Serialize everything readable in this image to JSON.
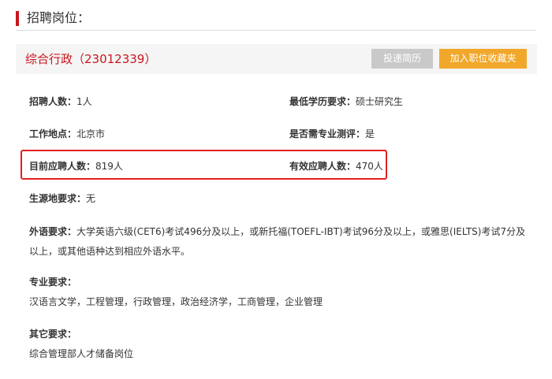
{
  "section": {
    "title": "招聘岗位："
  },
  "job": {
    "title": "综合行政（23012339）",
    "submit_label": "投递简历",
    "favorite_label": "加入职位收藏夹"
  },
  "info": {
    "headcount": {
      "label": "招聘人数：",
      "value": "1人"
    },
    "education": {
      "label": "最低学历要求：",
      "value": "硕士研究生"
    },
    "location": {
      "label": "工作地点：",
      "value": "北京市"
    },
    "assessment": {
      "label": "是否需专业测评：",
      "value": "是"
    },
    "current_applicants": {
      "label": "目前应聘人数：",
      "value": "819人"
    },
    "valid_applicants": {
      "label": "有效应聘人数：",
      "value": "470人"
    },
    "origin": {
      "label": "生源地要求：",
      "value": "无"
    },
    "language": {
      "label": "外语要求：",
      "value": "大学英语六级(CET6)考试496分及以上，或新托福(TOEFL-IBT)考试96分及以上，或雅思(IELTS)考试7分及以上，或其他语种达到相应外语水平。"
    },
    "major": {
      "label": "专业要求：",
      "value": "汉语言文学，工程管理，行政管理，政治经济学，工商管理，企业管理"
    },
    "other": {
      "label": "其它要求：",
      "value": "综合管理部人才储备岗位"
    }
  }
}
